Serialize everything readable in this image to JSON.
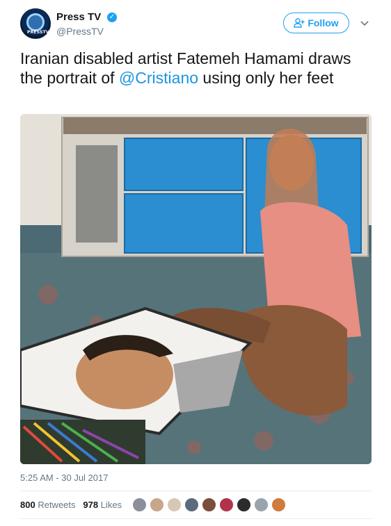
{
  "account": {
    "name": "Press TV",
    "handle": "@PressTV",
    "avatar_label": "PRESSTV",
    "verified_icon": "verified-badge-icon"
  },
  "actions": {
    "follow_label": "Follow"
  },
  "tweet": {
    "text_before": "Iranian disabled artist Fatemeh Hamami draws the portrait of ",
    "mention": "@Cristiano",
    "text_after": " using only her feet"
  },
  "meta": {
    "timestamp": "5:25 AM - 30 Jul 2017"
  },
  "stats": {
    "retweets_count": "800",
    "retweets_label": "Retweets",
    "likes_count": "978",
    "likes_label": "Likes"
  },
  "likers": [
    {
      "color": "#8a8f9a"
    },
    {
      "color": "#c9a58a"
    },
    {
      "color": "#d8c7b5"
    },
    {
      "color": "#5b6b7c"
    },
    {
      "color": "#7a4e3a"
    },
    {
      "color": "#b2324a"
    },
    {
      "color": "#2b2b2b"
    },
    {
      "color": "#9aa4ad"
    },
    {
      "color": "#d07a3d"
    }
  ],
  "colors": {
    "accent": "#1da1f2",
    "mention": "#1b95e0",
    "muted": "#657786"
  }
}
